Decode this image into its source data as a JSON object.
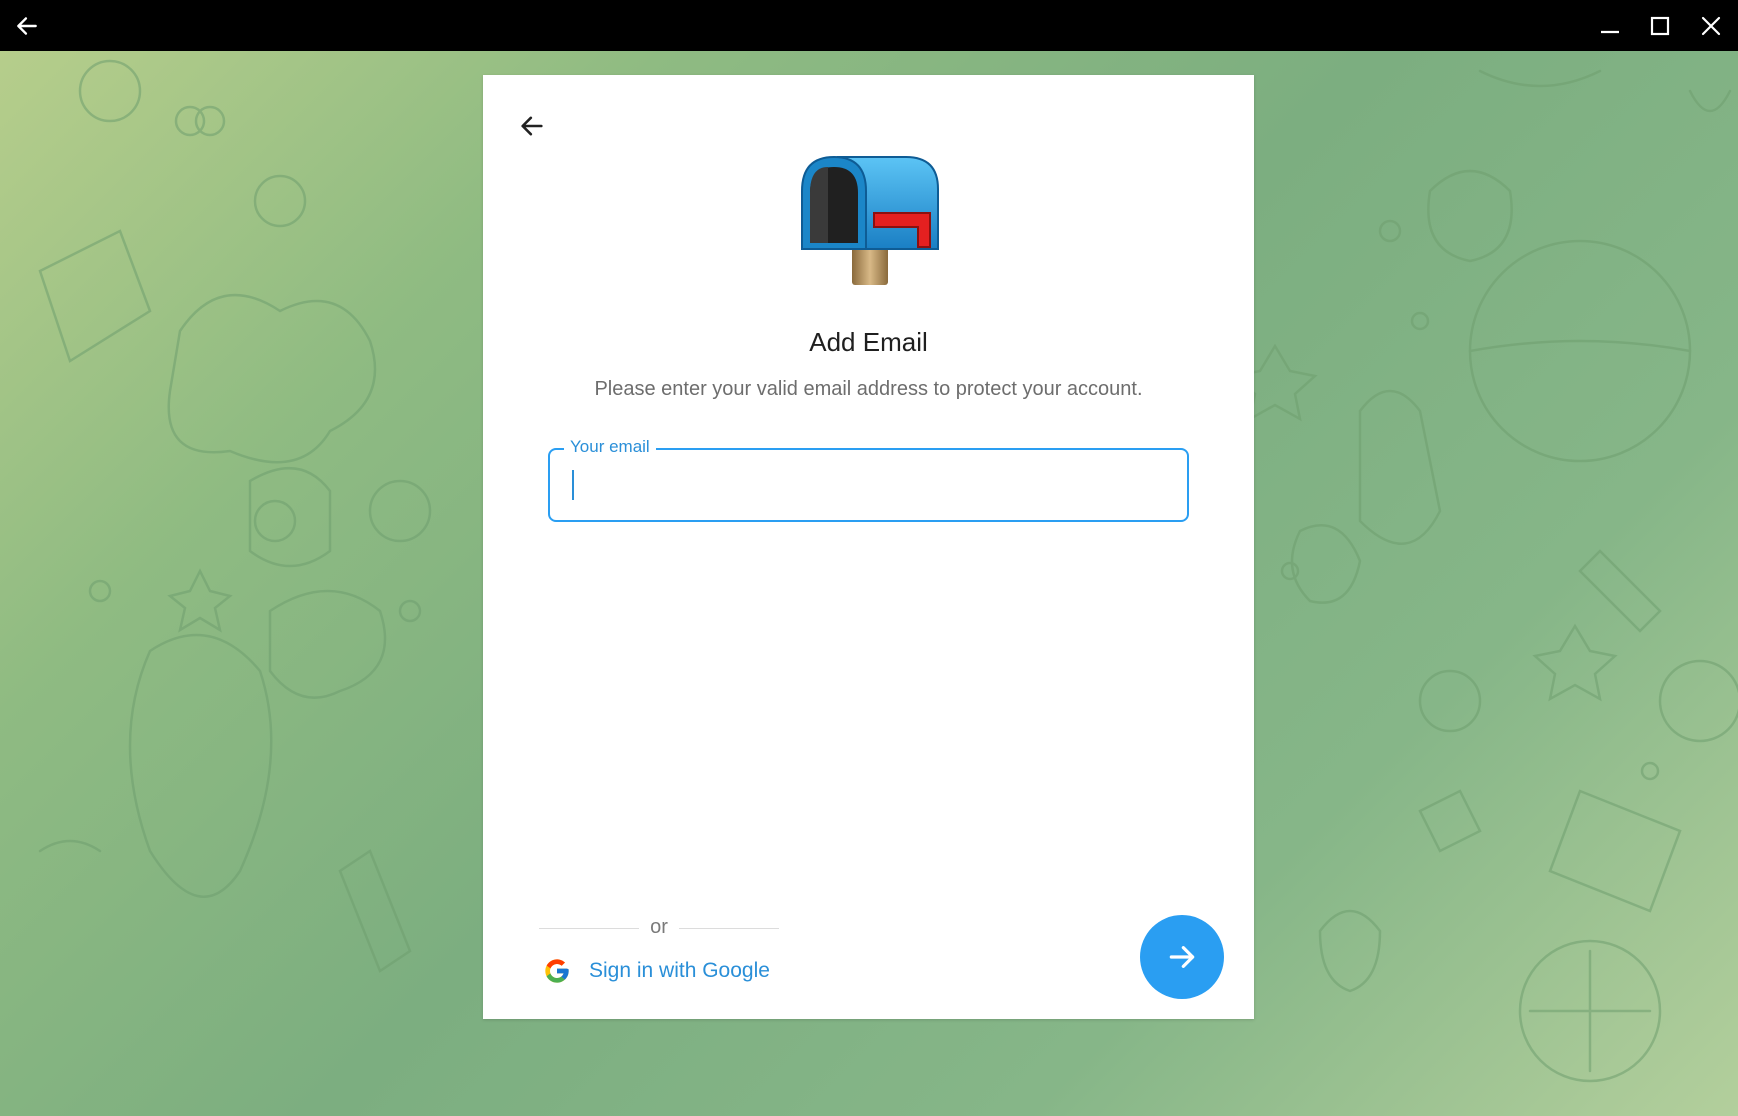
{
  "window": {
    "back_icon": "arrow-left-icon",
    "minimize_icon": "minimize-icon",
    "maximize_icon": "maximize-icon",
    "close_icon": "close-icon"
  },
  "card": {
    "back_icon": "arrow-left-icon",
    "illustration": "mailbox-icon",
    "title": "Add Email",
    "subtitle": "Please enter your valid email address to protect your account.",
    "email": {
      "label": "Your email",
      "value": "",
      "placeholder": ""
    },
    "divider_text": "or",
    "google": {
      "icon": "google-icon",
      "label": "Sign in with Google"
    },
    "next_icon": "arrow-right-icon"
  },
  "colors": {
    "accent": "#2a9ef2",
    "link": "#2a8fd8",
    "title_text": "#1f1f1f",
    "subtitle_text": "#6d6d6d"
  }
}
